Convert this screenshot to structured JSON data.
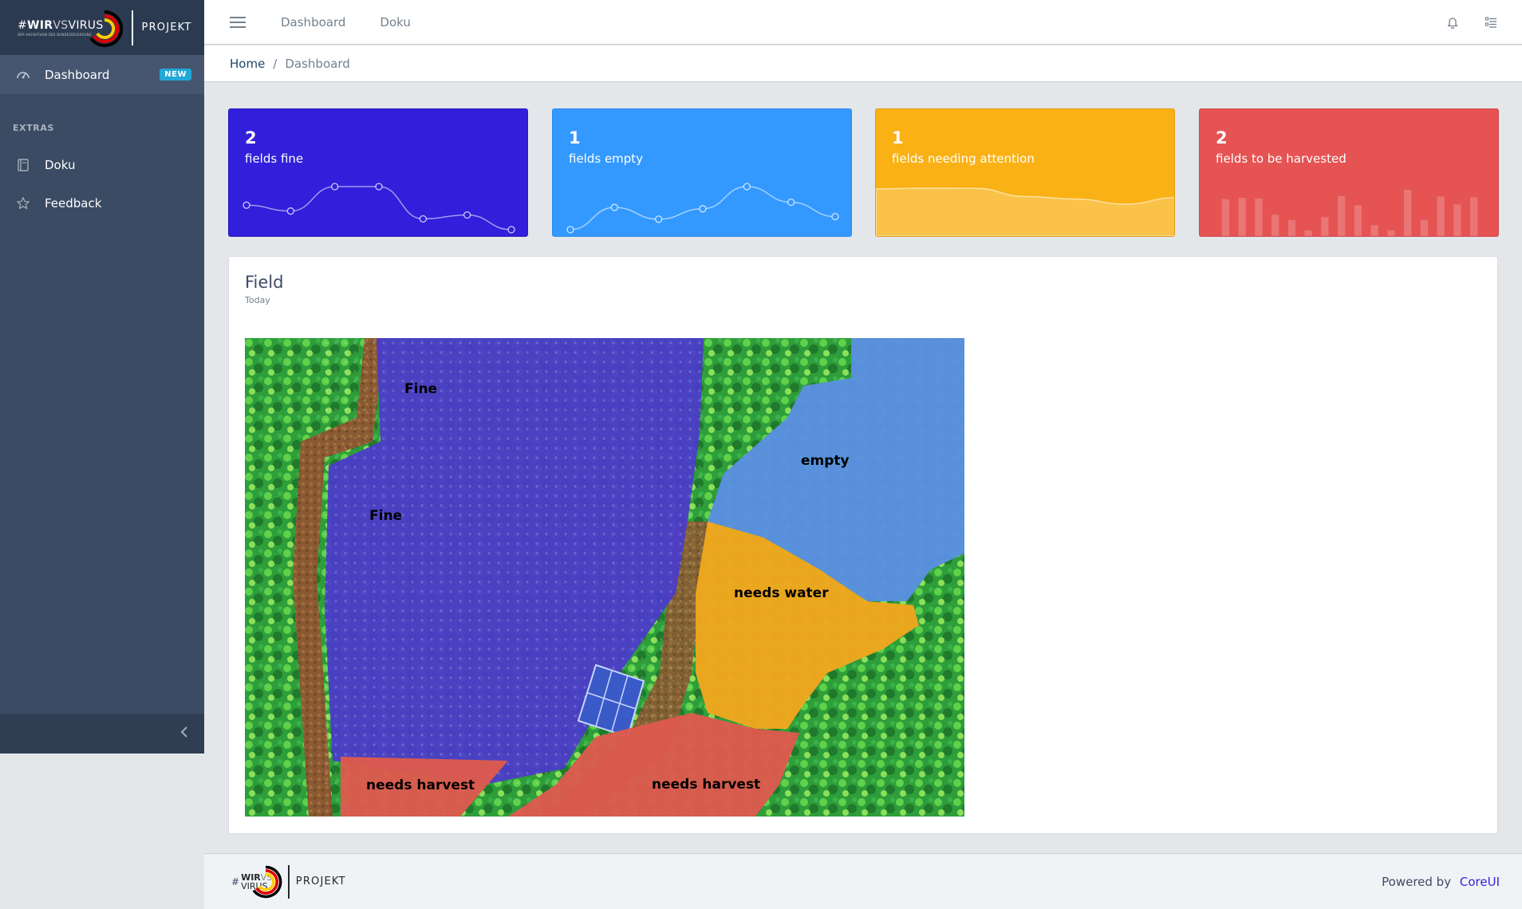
{
  "brand": {
    "hash": "#",
    "wir": "WIR",
    "vs": "VS",
    "virus": "VIRUS",
    "tagline": "DER HACKATHON DER BUNDESREGIERUNG",
    "projekt": "PROJEKT"
  },
  "sidebar": {
    "items": [
      {
        "label": "Dashboard",
        "badge": "NEW",
        "icon": "speedometer-icon"
      }
    ],
    "section_title": "EXTRAS",
    "extras": [
      {
        "label": "Doku",
        "icon": "book-icon"
      },
      {
        "label": "Feedback",
        "icon": "star-icon"
      }
    ]
  },
  "header": {
    "nav": [
      "Dashboard",
      "Doku"
    ],
    "icons": [
      "bell-icon",
      "list-icon"
    ]
  },
  "breadcrumb": {
    "home": "Home",
    "current": "Dashboard"
  },
  "stats": [
    {
      "value": "2",
      "label": "fields fine",
      "color": "#321fdb",
      "chart": "line",
      "series": [
        65,
        59,
        84,
        84,
        51,
        55,
        40
      ]
    },
    {
      "value": "1",
      "label": "fields empty",
      "color": "#3399ff",
      "chart": "line",
      "series": [
        1,
        18,
        9,
        17,
        34,
        22,
        11
      ]
    },
    {
      "value": "1",
      "label": "fields needing attention",
      "color": "#f9b115",
      "chart": "area",
      "series": [
        78,
        81,
        80,
        45,
        34,
        12,
        40
      ]
    },
    {
      "value": "2",
      "label": "fields to be harvested",
      "color": "#e55353",
      "chart": "bar",
      "series": [
        78,
        81,
        80,
        45,
        34,
        12,
        40,
        85,
        65,
        23,
        12,
        98,
        34,
        84,
        67,
        82
      ]
    }
  ],
  "field": {
    "title": "Field",
    "subtitle": "Today",
    "labels": [
      "Fine",
      "Fine",
      "empty",
      "needs water",
      "needs harvest",
      "needs harvest"
    ],
    "zone_colors": {
      "fine": "#4b3cc8",
      "empty": "#5a8fe0",
      "needs_water": "#f0a61e",
      "needs_harvest": "#dc5a4e",
      "vegetation": "#2e9e3a"
    }
  },
  "footer": {
    "projekt": "PROJEKT",
    "powered_by": "Powered by",
    "link": "CoreUI"
  }
}
